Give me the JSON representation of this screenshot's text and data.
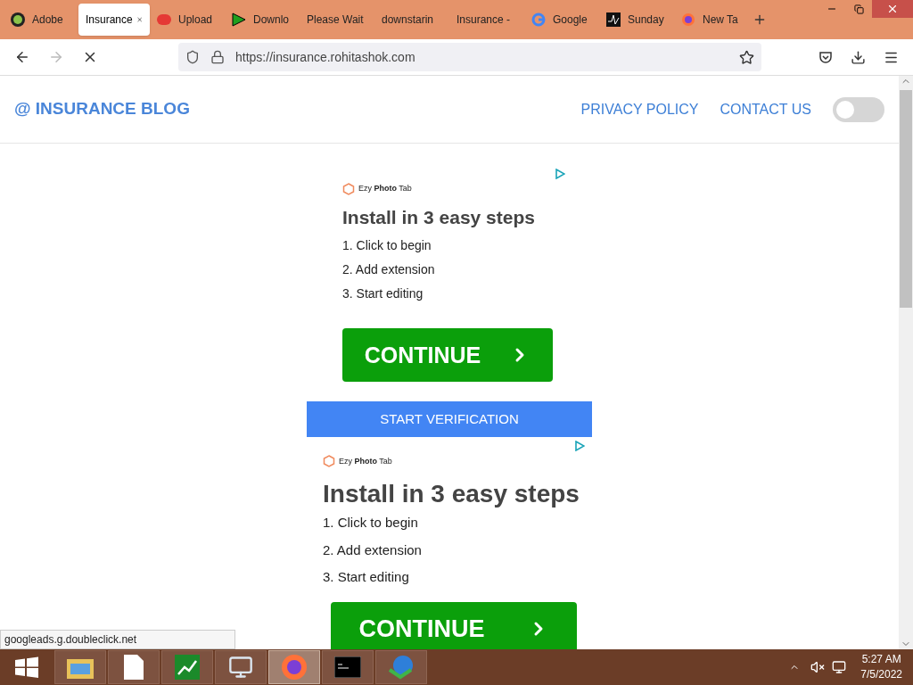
{
  "tabs": [
    {
      "title": "Adobe",
      "kind": "zz",
      "selected": false
    },
    {
      "title": "Insurance",
      "kind": "none",
      "selected": true
    },
    {
      "title": "Upload",
      "kind": "ev",
      "selected": false
    },
    {
      "title": "Downlo",
      "kind": "arrow",
      "selected": false
    },
    {
      "title": "Please Wait",
      "kind": "none",
      "selected": false
    },
    {
      "title": "downstarin",
      "kind": "none",
      "selected": false
    },
    {
      "title": "Insurance -",
      "kind": "none",
      "selected": false
    },
    {
      "title": "Google",
      "kind": "google",
      "selected": false
    },
    {
      "title": "Sunday",
      "kind": "sunday",
      "selected": false
    },
    {
      "title": "New Ta",
      "kind": "firefox",
      "selected": false
    }
  ],
  "address": {
    "url": "https://insurance.rohitashok.com"
  },
  "site": {
    "logo": "@ INSURANCE BLOG",
    "nav": [
      "PRIVACY POLICY",
      "CONTACT US"
    ],
    "theme_toggle": {
      "on": false
    }
  },
  "ads": [
    {
      "brand": "Ezy **Photo** Tab",
      "heading": "Install in 3 easy steps",
      "steps": [
        "1. Click to begin",
        "2. Add extension",
        "3. Start editing"
      ],
      "button": "CONTINUE"
    },
    {
      "brand": "Ezy **Photo** Tab",
      "heading": "Install in 3 easy steps",
      "steps": [
        "1. Click to begin",
        "2. Add extension",
        "3. Start editing"
      ],
      "button": "CONTINUE"
    }
  ],
  "verify_button": "START VERIFICATION",
  "status_text": "googleads.g.doubleclick.net",
  "taskbar": {
    "apps": [
      {
        "kind": "explorer",
        "selected": false
      },
      {
        "kind": "file",
        "selected": false
      },
      {
        "kind": "chart",
        "selected": false
      },
      {
        "kind": "monitor",
        "selected": false
      },
      {
        "kind": "firefox",
        "selected": true
      },
      {
        "kind": "terminal",
        "selected": false
      },
      {
        "kind": "globe",
        "selected": false
      }
    ],
    "time": "5:27 AM",
    "date": "7/5/2022"
  }
}
